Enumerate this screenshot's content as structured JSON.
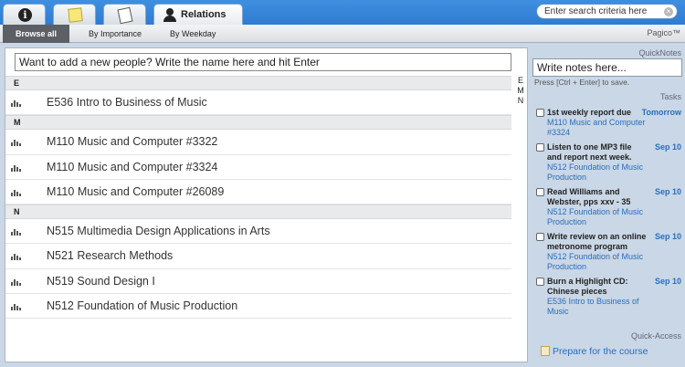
{
  "tabs": [
    {
      "icon": "info-icon"
    },
    {
      "icon": "sticky-note-icon"
    },
    {
      "icon": "document-icon"
    },
    {
      "icon": "person-icon",
      "label": "Relations"
    }
  ],
  "search": {
    "placeholder": "Enter search criteria here"
  },
  "subnav": {
    "items": [
      "Browse all",
      "By Importance",
      "By Weekday"
    ],
    "brand": "Pagico™"
  },
  "main": {
    "add_placeholder": "Want to add a new people? Write the name here and hit Enter",
    "index_letters": [
      "E",
      "M",
      "N"
    ],
    "sections": [
      {
        "letter": "E",
        "items": [
          "E536 Intro to Business of Music"
        ]
      },
      {
        "letter": "M",
        "items": [
          "M110 Music and Computer #3322",
          "M110 Music and Computer #3324",
          "M110 Music and Computer #26089"
        ]
      },
      {
        "letter": "N",
        "items": [
          "N515 Multimedia Design Applications in Arts",
          "N521 Research Methods",
          "N519 Sound Design I",
          "N512 Foundation of Music Production"
        ]
      }
    ]
  },
  "side": {
    "quicknotes_title": "QuickNotes",
    "notes_placeholder": "Write notes here...",
    "hint": "Press [Ctrl + Enter] to save.",
    "tasks_title": "Tasks",
    "tasks": [
      {
        "title": "1st weekly report due",
        "due": "Tomorrow",
        "class": "M110 Music and Computer #3324"
      },
      {
        "title": "Listen to one MP3 file and report next week.",
        "due": "Sep 10",
        "class": "N512 Foundation of Music Production"
      },
      {
        "title": "Read Williams and Webster, pps xxv - 35",
        "due": "Sep 10",
        "class": "N512 Foundation of Music Production"
      },
      {
        "title": "Write review on an online metronome program",
        "due": "Sep 10",
        "class": "N512 Foundation of Music Production"
      },
      {
        "title": "Burn a Highlight CD: Chinese pieces",
        "due": "Sep 10",
        "class": "E536 Intro to Business of Music"
      }
    ],
    "quickaccess_title": "Quick-Access",
    "quickaccess_link": "Prepare for the course"
  }
}
